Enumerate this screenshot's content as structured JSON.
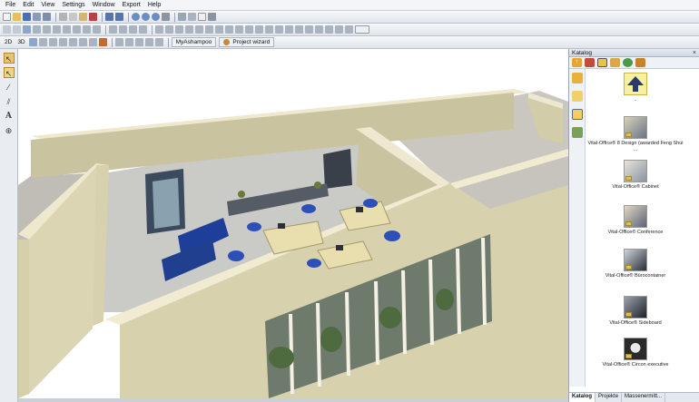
{
  "menu": [
    "File",
    "Edit",
    "View",
    "Settings",
    "Window",
    "Export",
    "Help"
  ],
  "toolbar": {
    "label_2d": "2D",
    "label_3d": "3D",
    "myashampoo_label": "MyAshampoo",
    "project_wizard_label": "Project wizard"
  },
  "left_toolbar": {
    "text_tool": "A"
  },
  "catalog": {
    "title": "Katalog",
    "close": "×",
    "items": [
      {
        "label": "..",
        "icon": "up-arrow-icon"
      },
      {
        "label": "Vital-Office® 8 Design (awarded Feng Shui ..."
      },
      {
        "label": "Vital-Office® Cabinet"
      },
      {
        "label": "Vital-Office® Conference"
      },
      {
        "label": "Vital-Office® Bürocontainer"
      },
      {
        "label": "Vital-Office® Sideboard"
      },
      {
        "label": "Vital-Office® Circon executive"
      }
    ],
    "tabs": [
      "Katalog",
      "Projekte",
      "Massenermitt..."
    ]
  },
  "colors": {
    "wall_top": "#e8e2c6",
    "wall_side": "#d6cfac",
    "floor": "#c8c8c4",
    "furniture_blue": "#1d3f9a",
    "desk_top": "#e9dfae"
  }
}
